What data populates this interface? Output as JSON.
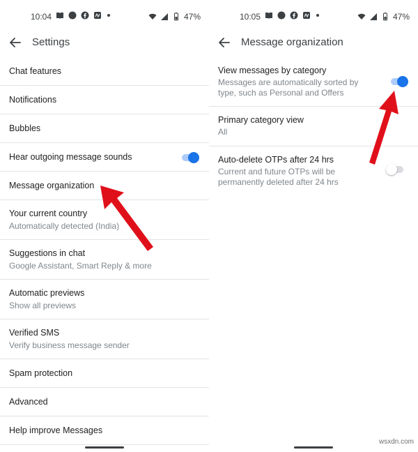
{
  "left": {
    "status": {
      "time": "10:04",
      "battery": "47%"
    },
    "title": "Settings",
    "items": [
      {
        "title": "Chat features"
      },
      {
        "title": "Notifications"
      },
      {
        "title": "Bubbles"
      },
      {
        "title": "Hear outgoing message sounds",
        "toggle": true
      },
      {
        "title": "Message organization"
      },
      {
        "title": "Your current country",
        "sub": "Automatically detected (India)"
      },
      {
        "title": "Suggestions in chat",
        "sub": "Google Assistant, Smart Reply & more"
      },
      {
        "title": "Automatic previews",
        "sub": "Show all previews"
      },
      {
        "title": "Verified SMS",
        "sub": "Verify business message sender"
      },
      {
        "title": "Spam protection"
      },
      {
        "title": "Advanced"
      },
      {
        "title": "Help improve Messages"
      }
    ]
  },
  "right": {
    "status": {
      "time": "10:05",
      "battery": "47%"
    },
    "title": "Message organization",
    "items": [
      {
        "title": "View messages by category",
        "sub1": "Messages are automatically sorted by",
        "sub2": "type, such as Personal and Offers",
        "toggle": true
      },
      {
        "title": "Primary category view",
        "sub1": "All"
      },
      {
        "title": "Auto-delete OTPs after 24 hrs",
        "sub1": "Current and future OTPs will be",
        "sub2": "permanently deleted after 24 hrs",
        "toggle": false
      }
    ]
  },
  "watermark": "wsxdn.com",
  "colors": {
    "accent": "#1a73e8",
    "arrow": "#e0101a",
    "divider": "#e3e3e3"
  }
}
